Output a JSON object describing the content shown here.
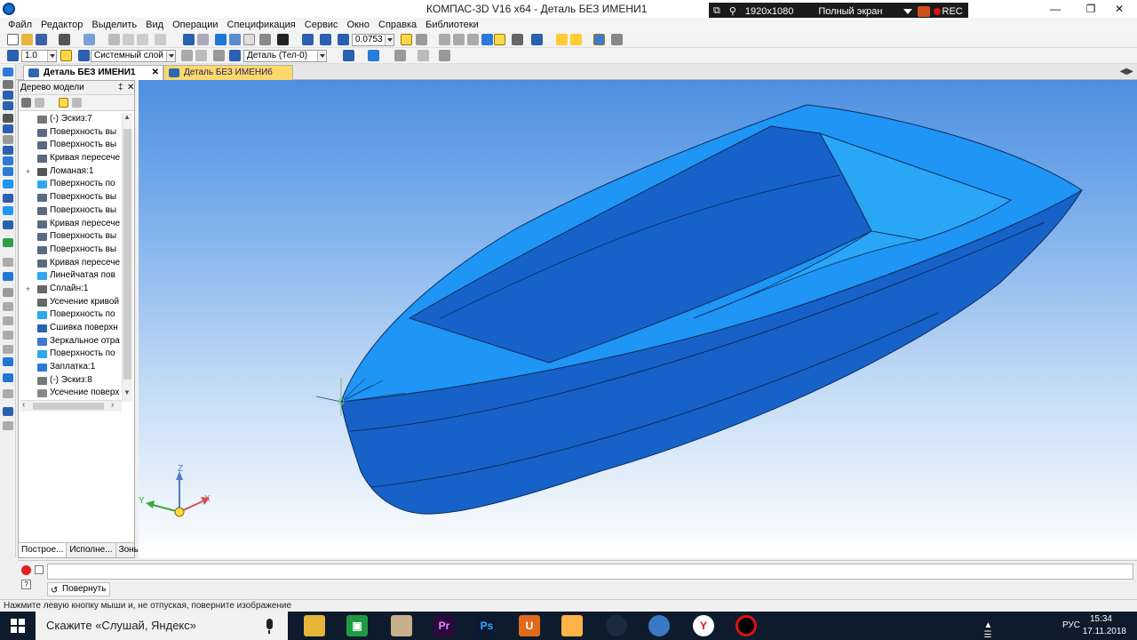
{
  "window": {
    "title": "КОМПАС-3D V16  x64 - Деталь БЕЗ ИМЕНИ1",
    "recorder": {
      "resolution": "1920x1080",
      "mode": "Полный экран",
      "rec_label": "REC"
    }
  },
  "menu": [
    "Файл",
    "Редактор",
    "Выделить",
    "Вид",
    "Операции",
    "Спецификация",
    "Сервис",
    "Окно",
    "Справка",
    "Библиотеки"
  ],
  "toolbar": {
    "zoom_value": "0.0753",
    "step_value": "1.0",
    "layer": "Системный слой",
    "part_select": "Деталь (Тел-0)"
  },
  "tabs": [
    {
      "label": "Деталь БЕЗ ИМЕНИ1",
      "active": true
    },
    {
      "label": "Деталь БЕЗ ИМЕНИ6",
      "active": false
    }
  ],
  "tree": {
    "title": "Дерево модели",
    "items": [
      {
        "label": "(-) Эскиз:7",
        "icon": "sketch-icon"
      },
      {
        "label": "Поверхность вы",
        "icon": "extrude-surface-icon"
      },
      {
        "label": "Поверхность вы",
        "icon": "extrude-surface-icon"
      },
      {
        "label": "Кривая пересече",
        "icon": "intersection-curve-icon"
      },
      {
        "label": "Ломаная:1",
        "icon": "polyline-icon",
        "expandable": true
      },
      {
        "label": "Поверхность по",
        "icon": "sweep-surface-icon"
      },
      {
        "label": "Поверхность вы",
        "icon": "extrude-surface-icon"
      },
      {
        "label": "Поверхность вы",
        "icon": "extrude-surface-icon"
      },
      {
        "label": "Кривая пересече",
        "icon": "intersection-curve-icon"
      },
      {
        "label": "Поверхность вы",
        "icon": "extrude-surface-icon"
      },
      {
        "label": "Поверхность вы",
        "icon": "extrude-surface-icon"
      },
      {
        "label": "Кривая пересече",
        "icon": "intersection-curve-icon"
      },
      {
        "label": "Линейчатая пов",
        "icon": "ruled-surface-icon"
      },
      {
        "label": "Сплайн:1",
        "icon": "spline-icon",
        "expandable": true
      },
      {
        "label": "Усечение кривой",
        "icon": "trim-curve-icon"
      },
      {
        "label": "Поверхность по",
        "icon": "sweep-surface-icon"
      },
      {
        "label": "Сшивка поверхн",
        "icon": "stitch-surface-icon"
      },
      {
        "label": "Зеркальное отра",
        "icon": "mirror-icon"
      },
      {
        "label": "Поверхность по",
        "icon": "sweep-surface-icon"
      },
      {
        "label": "Заплатка:1",
        "icon": "patch-icon"
      },
      {
        "label": "(-) Эскиз:8",
        "icon": "sketch-icon"
      },
      {
        "label": "Усечение поверх",
        "icon": "trim-surface-icon"
      }
    ],
    "bottom_tabs": [
      "Построе...",
      "Исполне...",
      "Зоны"
    ]
  },
  "axes": {
    "x": "X",
    "y": "Y",
    "z": "Z"
  },
  "command": {
    "rotate_label": "Повернуть"
  },
  "status": "Нажмите левую кнопку мыши и, не отпуская, поверните изображение",
  "taskbar": {
    "search_placeholder": "Скажите «Слушай, Яндекс»",
    "lang": "РУС",
    "time": "15:34",
    "date": "17.11.2018"
  },
  "colors": {
    "hull_light": "#1f95f5",
    "hull_dark": "#1762c8",
    "accent": "#ffd86a"
  }
}
